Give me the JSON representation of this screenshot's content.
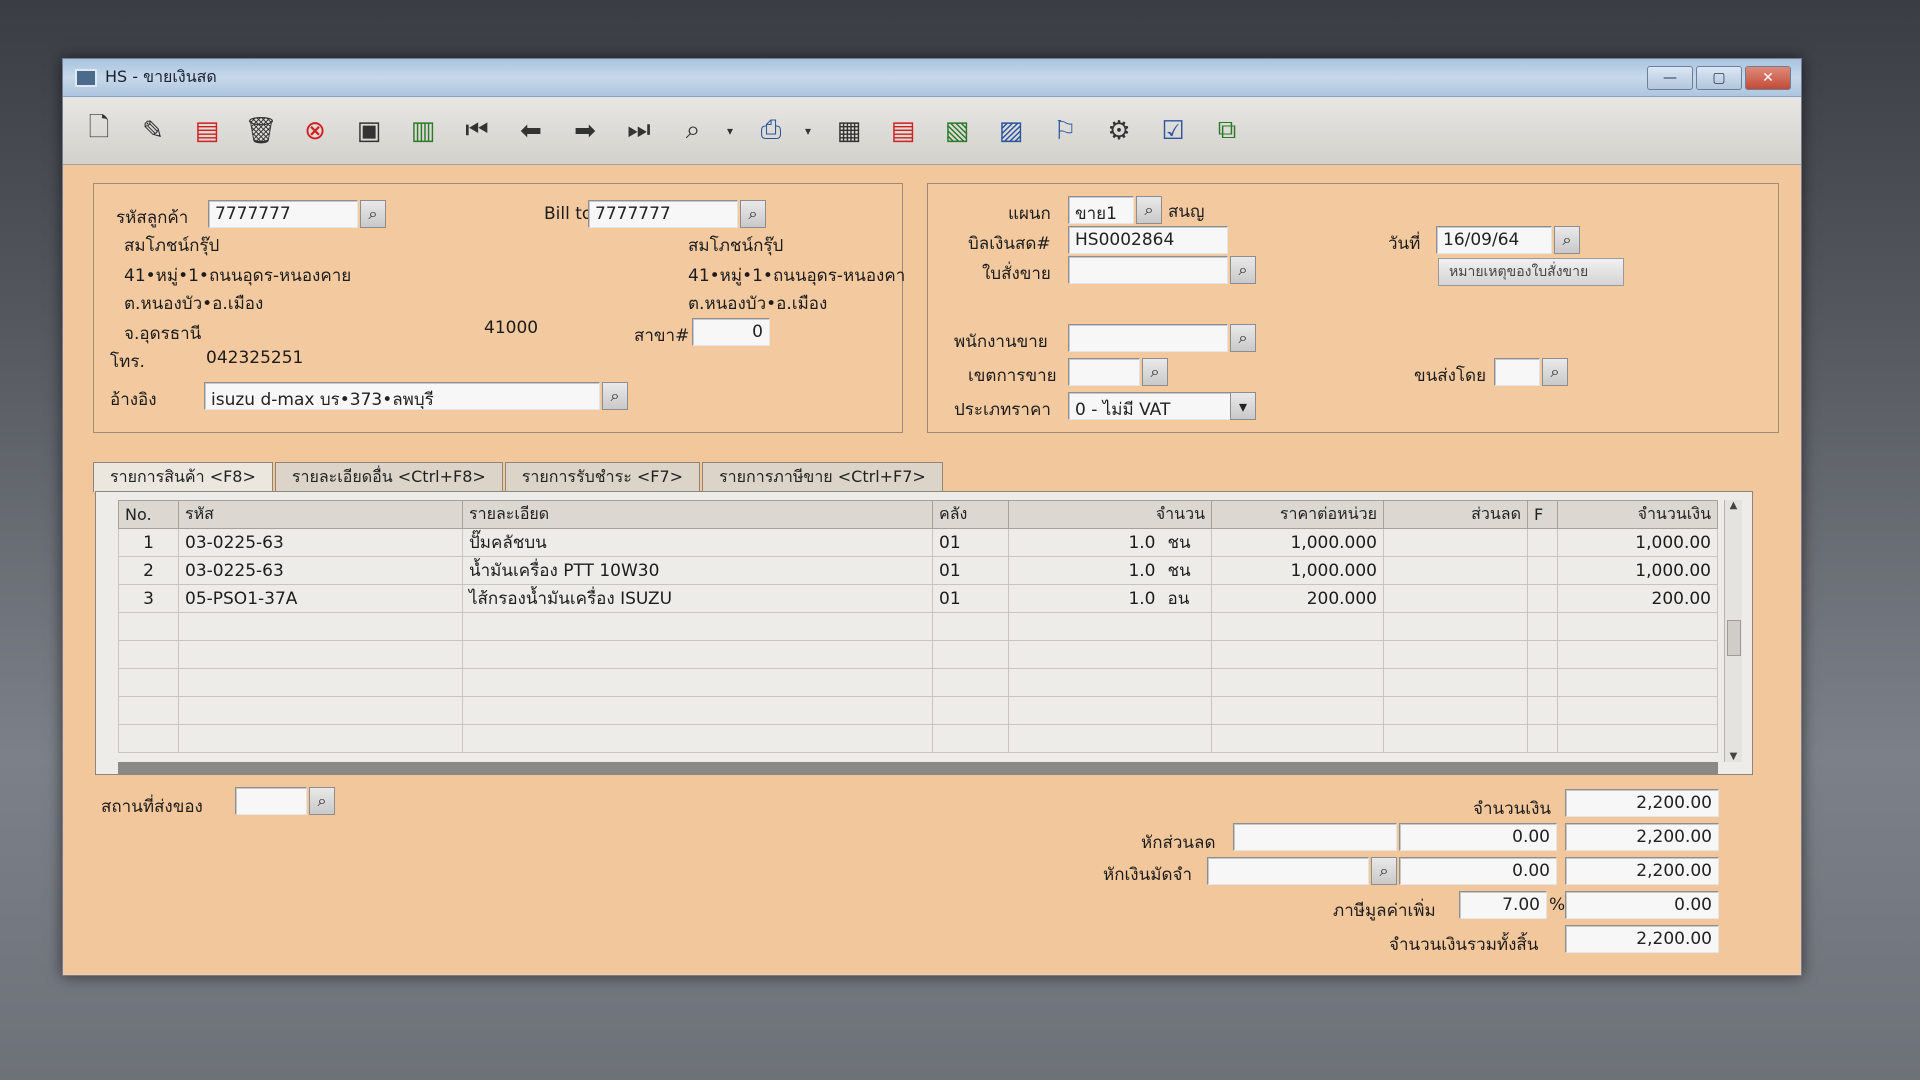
{
  "window": {
    "title": "HS - ขายเงินสด"
  },
  "customer": {
    "code_label": "รหัสลูกค้า",
    "code": "7777777",
    "name": "สมโภชน์กรุ๊ป",
    "address1": "41•หมู่•1•ถนนอุดร-หนองคาย",
    "address2": "ต.หนองบัว•อ.เมือง",
    "province": "จ.อุดรธานี",
    "postcode": "41000",
    "phone_label": "โทร.",
    "phone": "042325251",
    "ref_label": "อ้างอิง",
    "ref": "isuzu d-max บร•373•ลพบุรี"
  },
  "billto": {
    "label": "Bill to",
    "code": "7777777",
    "name": "สมโภชน์กรุ๊ป",
    "address1": "41•หมู่•1•ถนนอุดร-หนองคา",
    "address2": "ต.หนองบัว•อ.เมือง",
    "branch_label": "สาขา#",
    "branch": "0"
  },
  "doc": {
    "dept_label": "แผนก",
    "dept": "ขาย1",
    "dept_name": "สนญ",
    "bill_label": "บิลเงินสด#",
    "bill": "HS0002864",
    "order_label": "ใบสั่งขาย",
    "order": "",
    "date_label": "วันที่",
    "date": "16/09/64",
    "note_btn": "หมายเหตุของใบสั่งขาย",
    "salesman_label": "พนักงานขาย",
    "salesman": "",
    "area_label": "เขตการขาย",
    "area": "",
    "ship_by_label": "ขนส่งโดย",
    "ship_by": "",
    "price_type_label": "ประเภทราคา",
    "price_type": "0 - ไม่มี VAT"
  },
  "tabs": [
    "รายการสินค้า <F8>",
    "รายละเอียดอื่น <Ctrl+F8>",
    "รายการรับชำระ <F7>",
    "รายการภาษีขาย <Ctrl+F7>"
  ],
  "grid": {
    "headers": [
      "No.",
      "รหัส",
      "รายละเอียด",
      "คลัง",
      "จำนวน",
      "ราคาต่อหน่วย",
      "ส่วนลด",
      "F",
      "จำนวนเงิน"
    ],
    "rows": [
      {
        "no": "1",
        "code": "03-0225-63",
        "desc": "ปั๊มคลัชบน",
        "wh": "01",
        "qty": "1.0",
        "unit": "ชน",
        "price": "1,000.000",
        "disc": "",
        "f": "",
        "amount": "1,000.00"
      },
      {
        "no": "2",
        "code": "03-0225-63",
        "desc": "น้ำมันเครื่อง PTT 10W30",
        "wh": "01",
        "qty": "1.0",
        "unit": "ชน",
        "price": "1,000.000",
        "disc": "",
        "f": "",
        "amount": "1,000.00"
      },
      {
        "no": "3",
        "code": "05-PSO1-37A",
        "desc": "ไส้กรองน้ำมันเครื่อง ISUZU",
        "wh": "01",
        "qty": "1.0",
        "unit": "อน",
        "price": "200.000",
        "disc": "",
        "f": "",
        "amount": "200.00"
      }
    ]
  },
  "footer": {
    "ship_place_label": "สถานที่ส่งของ",
    "amount_label": "จำนวนเงิน",
    "amount": "2,200.00",
    "discount_label": "หักส่วนลด",
    "discount": "0.00",
    "after_discount": "2,200.00",
    "deposit_label": "หักเงินมัดจำ",
    "deposit": "0.00",
    "after_deposit": "2,200.00",
    "vat_label": "ภาษีมูลค่าเพิ่ม",
    "vat_rate": "7.00",
    "vat_pct": "%",
    "vat": "0.00",
    "total_label": "จำนวนเงินรวมทั้งสิ้น",
    "total": "2,200.00"
  },
  "icons": [
    "new-icon",
    "edit-icon",
    "void-icon",
    "trash-icon",
    "cancel-icon",
    "save-icon",
    "books-icon",
    "first-icon",
    "prev-icon",
    "next-icon",
    "last-icon",
    "find-icon",
    "print-icon",
    "calc-icon",
    "report-icon",
    "chart-icon",
    "return-icon",
    "approve-icon",
    "check-icon",
    "ok-icon",
    "network-icon"
  ]
}
